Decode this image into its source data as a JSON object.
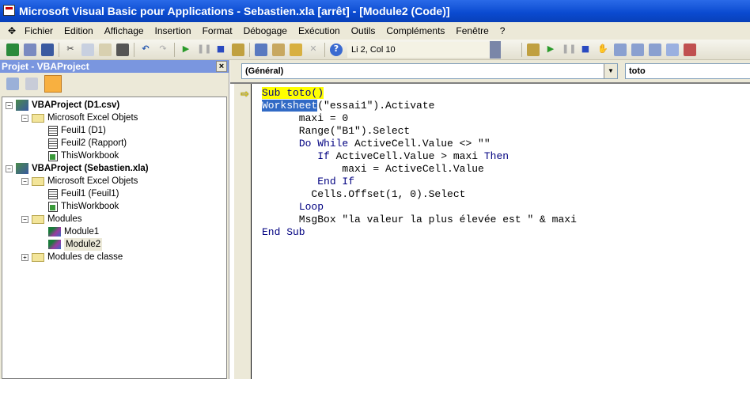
{
  "window": {
    "title": "Microsoft Visual Basic pour Applications - Sebastien.xla [arrêt] - [Module2 (Code)]"
  },
  "menu": [
    "Fichier",
    "Edition",
    "Affichage",
    "Insertion",
    "Format",
    "Débogage",
    "Exécution",
    "Outils",
    "Compléments",
    "Fenêtre",
    "?"
  ],
  "toolbar": {
    "position": "Li 2, Col 10"
  },
  "project": {
    "title": "Projet - VBAProject",
    "close": "×",
    "tree": [
      {
        "label": "VBAProject (D1.csv)",
        "level": 0,
        "type": "project",
        "expander": "−"
      },
      {
        "label": "Microsoft Excel Objets",
        "level": 1,
        "type": "folder",
        "expander": "−"
      },
      {
        "label": "Feuil1 (D1)",
        "level": 2,
        "type": "sheet"
      },
      {
        "label": "Feuil2 (Rapport)",
        "level": 2,
        "type": "sheet"
      },
      {
        "label": "ThisWorkbook",
        "level": 2,
        "type": "workbook"
      },
      {
        "label": "VBAProject (Sebastien.xla)",
        "level": 0,
        "type": "project",
        "expander": "−"
      },
      {
        "label": "Microsoft Excel Objets",
        "level": 1,
        "type": "folder",
        "expander": "−"
      },
      {
        "label": "Feuil1 (Feuil1)",
        "level": 2,
        "type": "sheet"
      },
      {
        "label": "ThisWorkbook",
        "level": 2,
        "type": "workbook"
      },
      {
        "label": "Modules",
        "level": 1,
        "type": "folder",
        "expander": "−"
      },
      {
        "label": "Module1",
        "level": 2,
        "type": "module"
      },
      {
        "label": "Module2",
        "level": 2,
        "type": "module",
        "selected": true
      },
      {
        "label": "Modules de classe",
        "level": 1,
        "type": "folder",
        "expander": "+"
      }
    ]
  },
  "code": {
    "object_combo": "(Général)",
    "proc_combo": "toto",
    "lines": {
      "l1": "Sub toto()",
      "l2a": "Worksheet",
      "l2b": "(\"essai1\").Activate",
      "l3": "      maxi = 0",
      "l4": "      Range(\"B1\").Select",
      "l5a": "Do While",
      "l5b": " ActiveCell.Value <> \"\"",
      "l6a": "If",
      "l6b": " ActiveCell.Value > maxi ",
      "l6c": "Then",
      "l7": "             maxi = ActiveCell.Value",
      "l8": "End If",
      "l9": "        Cells.Offset(1, 0).Select",
      "l10": "Loop",
      "l11": "      MsgBox \"la valeur la plus élevée est \" & maxi",
      "l12": "End Sub"
    }
  }
}
